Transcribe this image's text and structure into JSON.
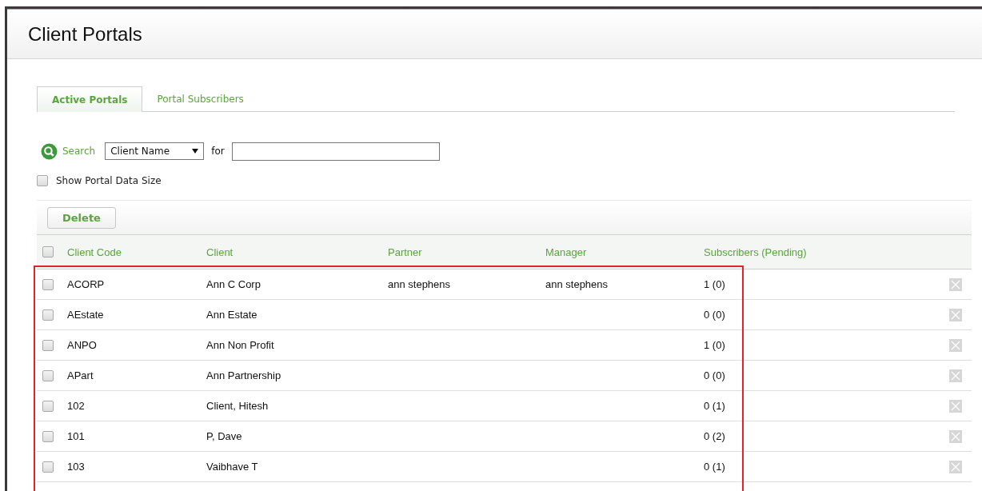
{
  "page": {
    "title": "Client Portals"
  },
  "tabs": [
    {
      "label": "Active Portals",
      "selected": true
    },
    {
      "label": "Portal Subscribers",
      "selected": false
    }
  ],
  "search": {
    "label": "Search",
    "field": "Client Name",
    "for_label": "for"
  },
  "show_data_size": {
    "label": "Show Portal Data Size",
    "checked": false
  },
  "toolbar": {
    "delete_label": "Delete"
  },
  "table": {
    "select_all_checked": false,
    "columns": [
      "Client Code",
      "Client",
      "Partner",
      "Manager",
      "Subscribers (Pending)"
    ],
    "rows": [
      {
        "checked": false,
        "code": "ACORP",
        "client": "Ann C Corp",
        "partner": "ann stephens",
        "manager": "ann stephens",
        "subscribers": "1 (0)"
      },
      {
        "checked": false,
        "code": "AEstate",
        "client": "Ann Estate",
        "subscribers": "0 (0)"
      },
      {
        "checked": false,
        "code": "ANPO",
        "client": "Ann Non Profit",
        "subscribers": "1 (0)"
      },
      {
        "checked": false,
        "code": "APart",
        "client": "Ann Partnership",
        "subscribers": "0 (0)"
      },
      {
        "checked": false,
        "code": "102",
        "client": "Client, Hitesh",
        "subscribers": "0 (1)"
      },
      {
        "checked": false,
        "code": "101",
        "client": "P, Dave",
        "subscribers": "0 (2)"
      },
      {
        "checked": false,
        "code": "103",
        "client": "Vaibhave T",
        "subscribers": "0 (1)"
      }
    ]
  }
}
